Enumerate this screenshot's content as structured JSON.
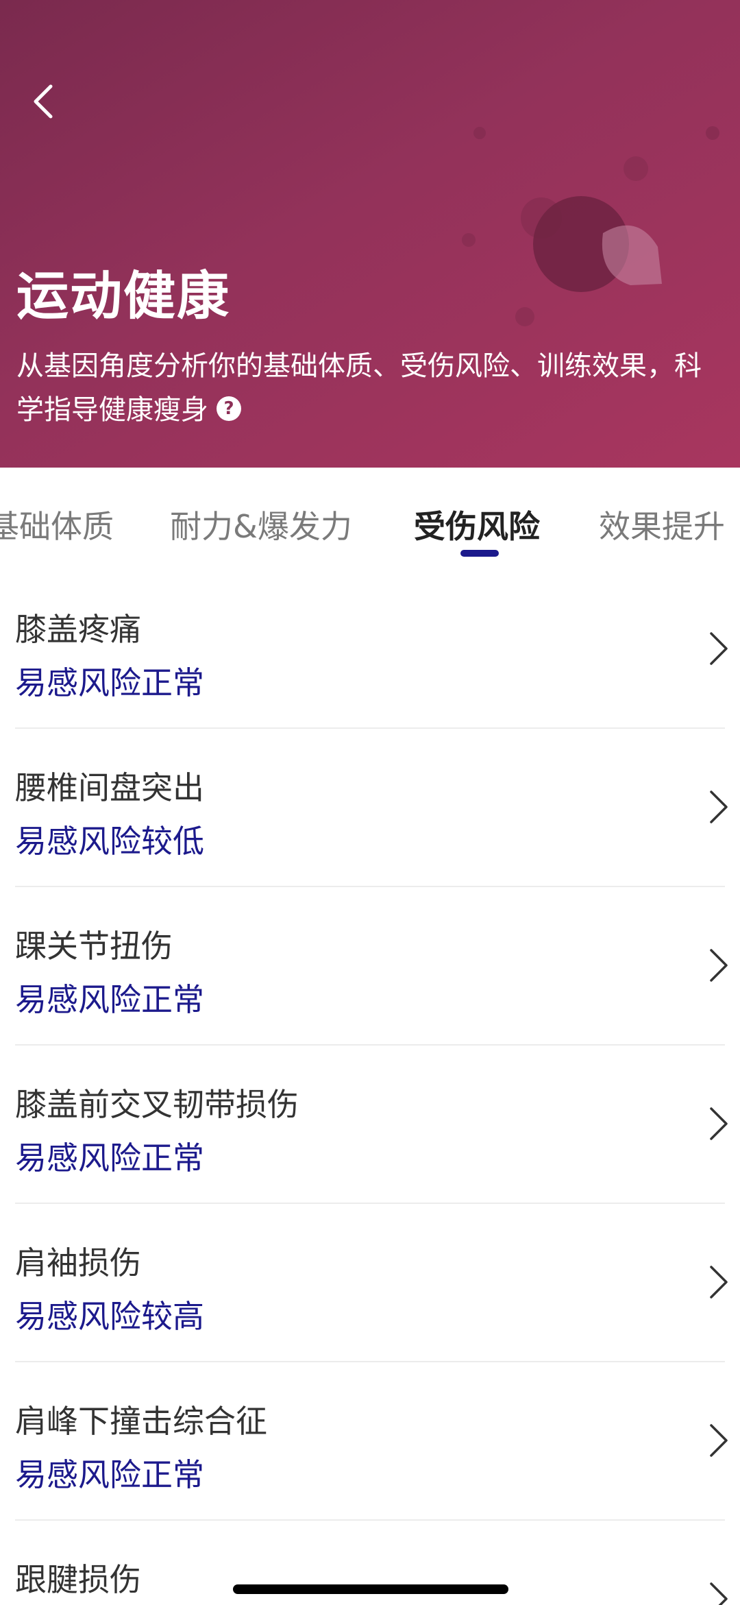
{
  "header": {
    "title": "运动健康",
    "subtitle": "从基因角度分析你的基础体质、受伤风险、训练效果，科学指导健康瘦身",
    "help_icon": "question-circle-icon",
    "back_icon": "chevron-left-icon",
    "gradient": [
      "#7a2a4e",
      "#a8365f"
    ]
  },
  "tabs": [
    {
      "label": "基础体质"
    },
    {
      "label": "耐力&爆发力"
    },
    {
      "label": "受伤风险"
    },
    {
      "label": "效果提升"
    }
  ],
  "active_tab": "受伤风险",
  "accent_color": "#1c1a8c",
  "items": [
    {
      "title": "膝盖疼痛",
      "status": "易感风险正常"
    },
    {
      "title": "腰椎间盘突出",
      "status": "易感风险较低"
    },
    {
      "title": "踝关节扭伤",
      "status": "易感风险正常"
    },
    {
      "title": "膝盖前交叉韧带损伤",
      "status": "易感风险正常"
    },
    {
      "title": "肩袖损伤",
      "status": "易感风险较高"
    },
    {
      "title": "肩峰下撞击综合征",
      "status": "易感风险正常"
    },
    {
      "title": "跟腱损伤",
      "status": ""
    }
  ]
}
